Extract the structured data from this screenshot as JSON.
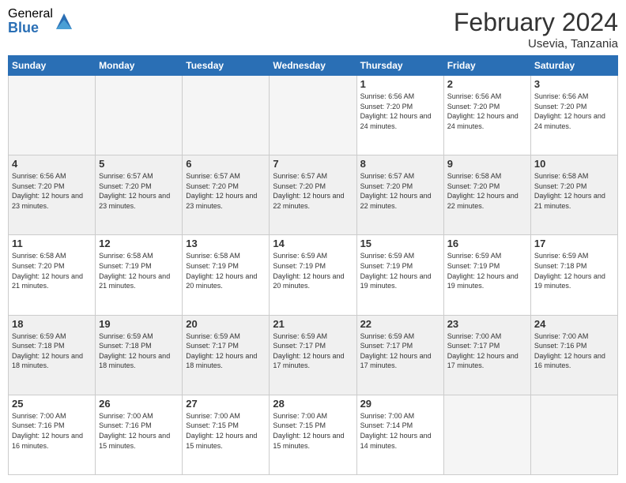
{
  "header": {
    "logo_general": "General",
    "logo_blue": "Blue",
    "month_title": "February 2024",
    "location": "Usevia, Tanzania"
  },
  "weekdays": [
    "Sunday",
    "Monday",
    "Tuesday",
    "Wednesday",
    "Thursday",
    "Friday",
    "Saturday"
  ],
  "weeks": [
    [
      {
        "day": "",
        "info": ""
      },
      {
        "day": "",
        "info": ""
      },
      {
        "day": "",
        "info": ""
      },
      {
        "day": "",
        "info": ""
      },
      {
        "day": "1",
        "info": "Sunrise: 6:56 AM\nSunset: 7:20 PM\nDaylight: 12 hours and 24 minutes."
      },
      {
        "day": "2",
        "info": "Sunrise: 6:56 AM\nSunset: 7:20 PM\nDaylight: 12 hours and 24 minutes."
      },
      {
        "day": "3",
        "info": "Sunrise: 6:56 AM\nSunset: 7:20 PM\nDaylight: 12 hours and 24 minutes."
      }
    ],
    [
      {
        "day": "4",
        "info": "Sunrise: 6:56 AM\nSunset: 7:20 PM\nDaylight: 12 hours and 23 minutes."
      },
      {
        "day": "5",
        "info": "Sunrise: 6:57 AM\nSunset: 7:20 PM\nDaylight: 12 hours and 23 minutes."
      },
      {
        "day": "6",
        "info": "Sunrise: 6:57 AM\nSunset: 7:20 PM\nDaylight: 12 hours and 23 minutes."
      },
      {
        "day": "7",
        "info": "Sunrise: 6:57 AM\nSunset: 7:20 PM\nDaylight: 12 hours and 22 minutes."
      },
      {
        "day": "8",
        "info": "Sunrise: 6:57 AM\nSunset: 7:20 PM\nDaylight: 12 hours and 22 minutes."
      },
      {
        "day": "9",
        "info": "Sunrise: 6:58 AM\nSunset: 7:20 PM\nDaylight: 12 hours and 22 minutes."
      },
      {
        "day": "10",
        "info": "Sunrise: 6:58 AM\nSunset: 7:20 PM\nDaylight: 12 hours and 21 minutes."
      }
    ],
    [
      {
        "day": "11",
        "info": "Sunrise: 6:58 AM\nSunset: 7:20 PM\nDaylight: 12 hours and 21 minutes."
      },
      {
        "day": "12",
        "info": "Sunrise: 6:58 AM\nSunset: 7:19 PM\nDaylight: 12 hours and 21 minutes."
      },
      {
        "day": "13",
        "info": "Sunrise: 6:58 AM\nSunset: 7:19 PM\nDaylight: 12 hours and 20 minutes."
      },
      {
        "day": "14",
        "info": "Sunrise: 6:59 AM\nSunset: 7:19 PM\nDaylight: 12 hours and 20 minutes."
      },
      {
        "day": "15",
        "info": "Sunrise: 6:59 AM\nSunset: 7:19 PM\nDaylight: 12 hours and 19 minutes."
      },
      {
        "day": "16",
        "info": "Sunrise: 6:59 AM\nSunset: 7:19 PM\nDaylight: 12 hours and 19 minutes."
      },
      {
        "day": "17",
        "info": "Sunrise: 6:59 AM\nSunset: 7:18 PM\nDaylight: 12 hours and 19 minutes."
      }
    ],
    [
      {
        "day": "18",
        "info": "Sunrise: 6:59 AM\nSunset: 7:18 PM\nDaylight: 12 hours and 18 minutes."
      },
      {
        "day": "19",
        "info": "Sunrise: 6:59 AM\nSunset: 7:18 PM\nDaylight: 12 hours and 18 minutes."
      },
      {
        "day": "20",
        "info": "Sunrise: 6:59 AM\nSunset: 7:17 PM\nDaylight: 12 hours and 18 minutes."
      },
      {
        "day": "21",
        "info": "Sunrise: 6:59 AM\nSunset: 7:17 PM\nDaylight: 12 hours and 17 minutes."
      },
      {
        "day": "22",
        "info": "Sunrise: 6:59 AM\nSunset: 7:17 PM\nDaylight: 12 hours and 17 minutes."
      },
      {
        "day": "23",
        "info": "Sunrise: 7:00 AM\nSunset: 7:17 PM\nDaylight: 12 hours and 17 minutes."
      },
      {
        "day": "24",
        "info": "Sunrise: 7:00 AM\nSunset: 7:16 PM\nDaylight: 12 hours and 16 minutes."
      }
    ],
    [
      {
        "day": "25",
        "info": "Sunrise: 7:00 AM\nSunset: 7:16 PM\nDaylight: 12 hours and 16 minutes."
      },
      {
        "day": "26",
        "info": "Sunrise: 7:00 AM\nSunset: 7:16 PM\nDaylight: 12 hours and 15 minutes."
      },
      {
        "day": "27",
        "info": "Sunrise: 7:00 AM\nSunset: 7:15 PM\nDaylight: 12 hours and 15 minutes."
      },
      {
        "day": "28",
        "info": "Sunrise: 7:00 AM\nSunset: 7:15 PM\nDaylight: 12 hours and 15 minutes."
      },
      {
        "day": "29",
        "info": "Sunrise: 7:00 AM\nSunset: 7:14 PM\nDaylight: 12 hours and 14 minutes."
      },
      {
        "day": "",
        "info": ""
      },
      {
        "day": "",
        "info": ""
      }
    ]
  ]
}
